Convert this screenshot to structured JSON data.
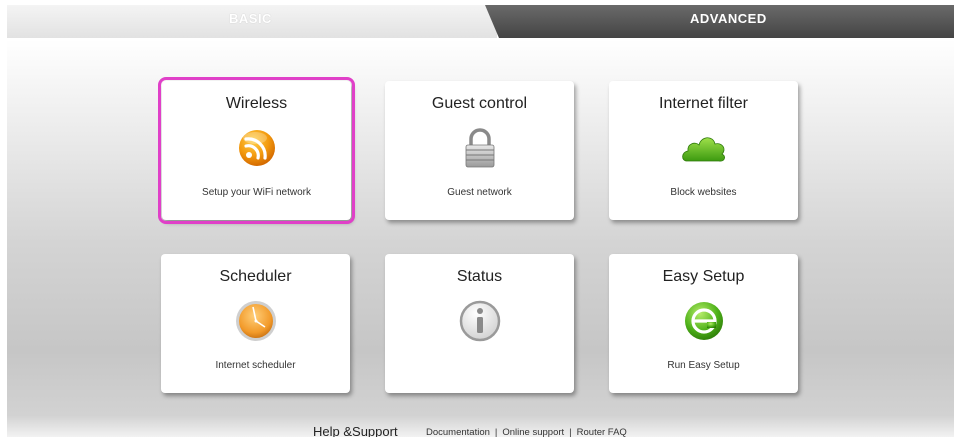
{
  "tabs": {
    "basic": "BASIC",
    "advanced": "ADVANCED"
  },
  "cards": [
    {
      "title": "Wireless",
      "subtitle": "Setup your WiFi network",
      "icon": "wifi-icon",
      "selected": true
    },
    {
      "title": "Guest control",
      "subtitle": "Guest network",
      "icon": "lock-icon"
    },
    {
      "title": "Internet filter",
      "subtitle": "Block websites",
      "icon": "cloud-icon"
    },
    {
      "title": "Scheduler",
      "subtitle": "Internet scheduler",
      "icon": "clock-icon"
    },
    {
      "title": "Status",
      "subtitle": "",
      "icon": "info-icon"
    },
    {
      "title": "Easy Setup",
      "subtitle": "Run Easy Setup",
      "icon": "easy-setup-icon"
    }
  ],
  "footer": {
    "help": "Help &Support",
    "links": [
      "Documentation",
      "Online support",
      "Router FAQ"
    ],
    "separator": "|"
  },
  "colors": {
    "selection": "#e040c8",
    "tab_advanced": "#4a4a4a"
  }
}
